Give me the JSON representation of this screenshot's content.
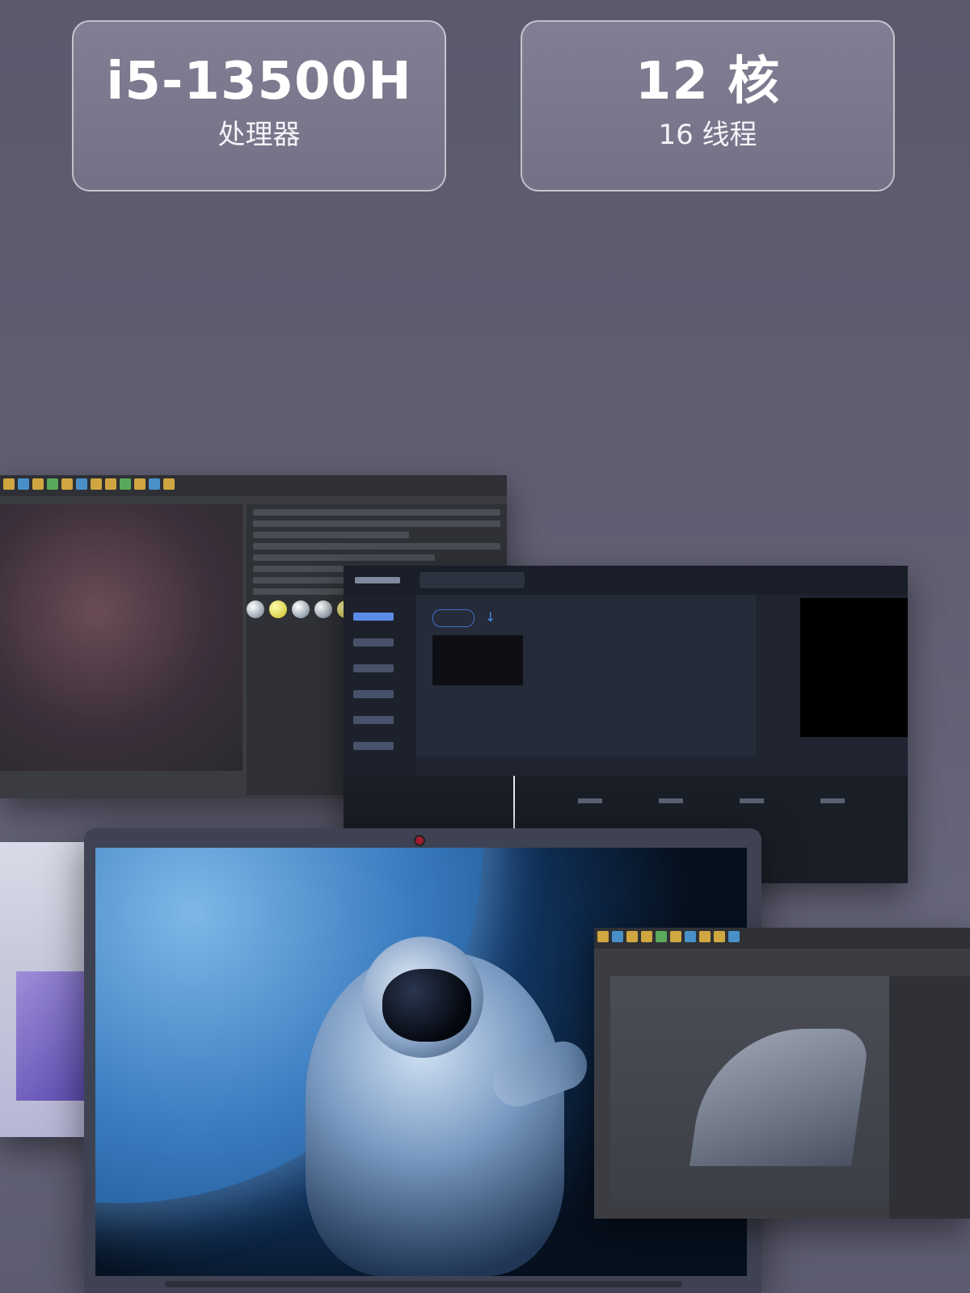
{
  "specs": [
    {
      "main": "i5-13500H",
      "sub": "处理器"
    },
    {
      "main": "12 核",
      "sub": "16 线程"
    }
  ],
  "colors": {
    "background": "#5f5e72",
    "card_border": "#ffffff",
    "editor_accent": "#4a8fe8"
  },
  "icons": [
    "download-icon",
    "camera-icon"
  ]
}
